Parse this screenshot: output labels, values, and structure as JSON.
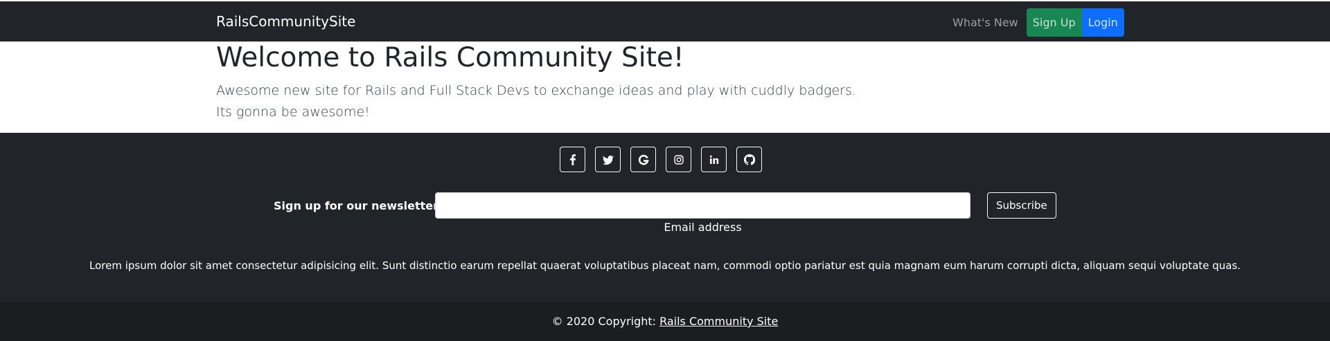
{
  "navbar": {
    "brand": "RailsCommunitySite",
    "whats_new": "What's New",
    "sign_up": "Sign Up",
    "login": "Login"
  },
  "hero": {
    "title": "Welcome to Rails Community Site!",
    "line1": "Awesome new site for Rails and Full Stack Devs to exchange ideas and play with cuddly badgers.",
    "line2": "Its gonna be awesome!"
  },
  "footer": {
    "social_icons": [
      "facebook-icon",
      "twitter-icon",
      "google-icon",
      "instagram-icon",
      "linkedin-icon",
      "github-icon"
    ],
    "newsletter_label": "Sign up for our newsletter",
    "email_value": "",
    "email_help": "Email address",
    "subscribe": "Subscribe",
    "lorem": "Lorem ipsum dolor sit amet consectetur adipisicing elit. Sunt distinctio earum repellat quaerat voluptatibus placeat nam, commodi optio pariatur est quia magnam eum harum corrupti dicta, aliquam sequi voluptate quas.",
    "copyright_prefix": "© 2020 Copyright:",
    "copyright_link": "Rails Community Site"
  },
  "colors": {
    "navbar_bg": "#212529",
    "signup_green": "#198754",
    "login_blue": "#0d6efd",
    "copyright_bg": "#1b1e21"
  }
}
